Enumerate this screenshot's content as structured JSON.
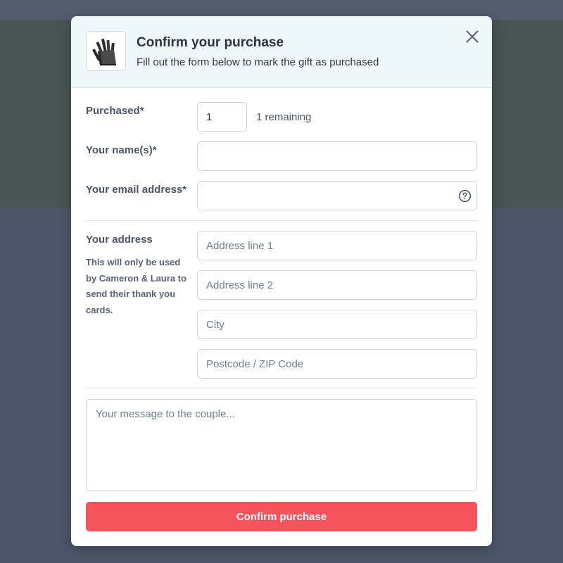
{
  "modal": {
    "title": "Confirm your purchase",
    "subtitle": "Fill out the form below to mark the gift as purchased",
    "gift_image_icon": "knife-block-icon",
    "close_icon": "close-icon"
  },
  "form": {
    "purchased": {
      "label": "Purchased*",
      "value": "1",
      "remaining": "1 remaining"
    },
    "name": {
      "label": "Your name(s)*",
      "value": "",
      "placeholder": ""
    },
    "email": {
      "label": "Your email address*",
      "value": "",
      "placeholder": "",
      "help_icon": "question-circle-icon"
    },
    "address": {
      "label": "Your address",
      "hint": "This will only be used by Cameron & Laura to send their thank you cards.",
      "line1_placeholder": "Address line 1",
      "line2_placeholder": "Address line 2",
      "city_placeholder": "City",
      "postcode_placeholder": "Postcode / ZIP Code"
    },
    "message_placeholder": "Your message to the couple...",
    "submit_label": "Confirm purchase"
  },
  "colors": {
    "accent": "#f5535e",
    "header_bg": "#eef7fa",
    "overlay": "#4b5668"
  }
}
